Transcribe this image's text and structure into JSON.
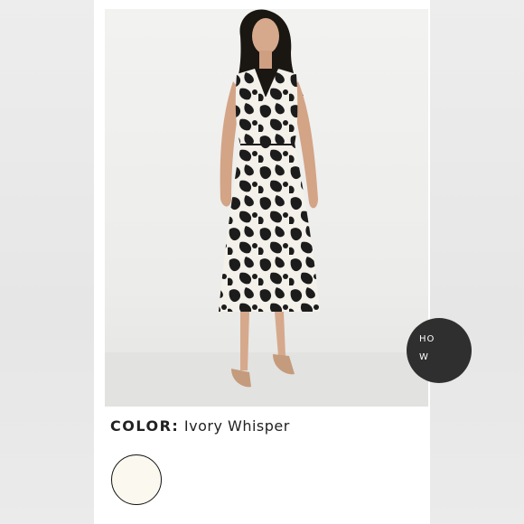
{
  "product": {
    "color_label": "COLOR:",
    "color_value": "Ivory Whisper",
    "swatch_color": "#fbf8ef"
  },
  "overlay_badge": {
    "line1": "HO",
    "line2": "W"
  },
  "colors": {
    "page_bg": "#ffffff",
    "dress_dark": "#1c1c1c",
    "dress_light": "#f4f1ea"
  }
}
